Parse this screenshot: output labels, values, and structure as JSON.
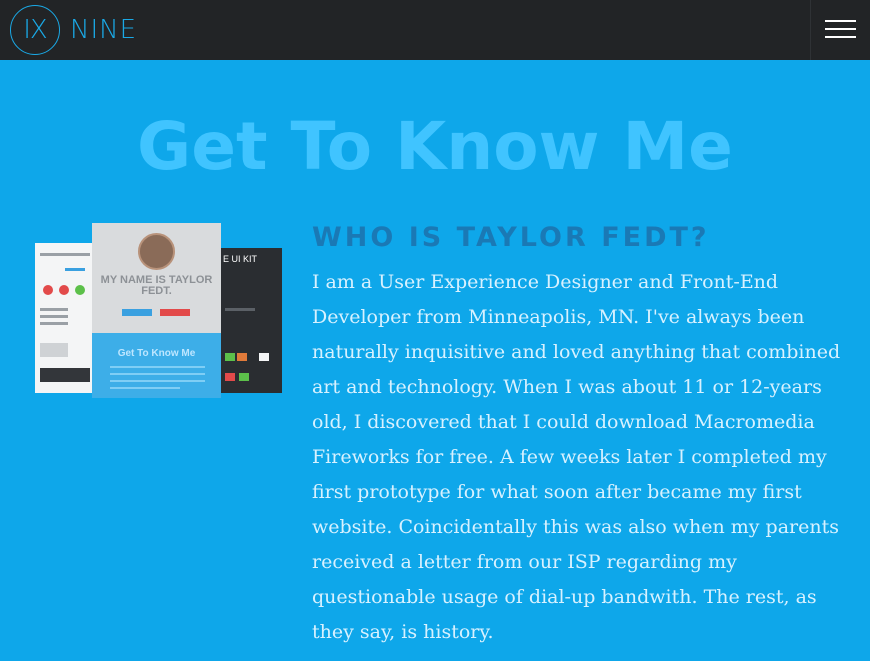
{
  "header": {
    "logo_mark": "IX",
    "logo_text": "NINE",
    "menu_icon": "hamburger-menu-icon"
  },
  "page": {
    "title": "Get To Know Me"
  },
  "about": {
    "heading": "WHO IS TAYLOR FEDT?",
    "bio": "I am a User Experience Designer and Front-End Developer from Minneapolis, MN. I've always been naturally inquisitive and loved anything that combined art and technology. When I was about 11 or 12-years old, I discovered that I could download Macromedia Fireworks for free. A few weeks later I completed my first prototype for what soon after became my first website. Coincidentally this was also when my parents received a letter from our ISP regarding my questionable usage of dial-up bandwith. The rest, as they say, is history."
  },
  "preview": {
    "center_name": "MY NAME IS TAYLOR FEDT.",
    "center_heading": "Get To Know Me",
    "right_title": "E UI KIT"
  },
  "colors": {
    "background": "#0ea7ea",
    "navbar": "#222426",
    "logo": "#1aa9e6",
    "title": "#40c4ff",
    "heading": "#1a79b5",
    "body_text": "#d7f1ff"
  }
}
